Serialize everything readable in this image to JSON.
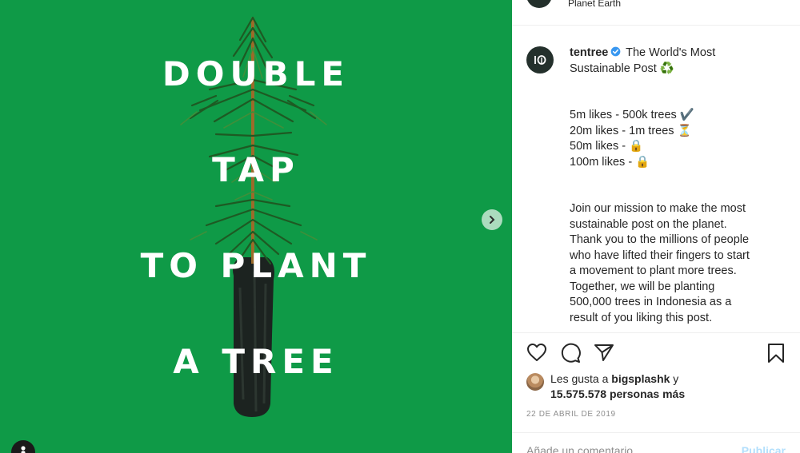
{
  "post": {
    "headline": [
      "DOUBLE",
      "TAP",
      "TO PLANT",
      "A TREE"
    ],
    "background_color": "#0f9a47",
    "next_icon": "chevron-right-icon",
    "user_tag_icon": "person-icon"
  },
  "header": {
    "location": "Planet Earth"
  },
  "caption": {
    "avatar_text": "10",
    "username": "tentree",
    "verified_icon": "verified-badge-icon",
    "lines": [
      "The World's Most",
      "Sustainable Post ♻️",
      "",
      "",
      "5m likes - 500k trees ✔️",
      "20m likes - 1m trees ⏳",
      "50m likes - 🔒",
      "100m likes - 🔒",
      "",
      "",
      "Join our mission to make the most",
      "sustainable post on the planet.",
      "Thank you to the millions of people",
      "who have lifted their fingers to start",
      "a movement to plant more trees.",
      "Together, we will be planting",
      "500,000 trees in Indonesia as a",
      "result of you liking this post."
    ]
  },
  "actions": {
    "like_icon": "heart-icon",
    "comment_icon": "comment-icon",
    "share_icon": "share-icon",
    "save_icon": "bookmark-icon"
  },
  "likes": {
    "prefix": "Les gusta a ",
    "user": "bigsplashk",
    "connector": " y",
    "count": "15.575.578 personas más"
  },
  "date": "22 DE ABRIL DE 2019",
  "comment": {
    "placeholder": "Añade un comentario...",
    "publish_label": "Publicar"
  },
  "colors": {
    "accent": "#0095f6",
    "publish_disabled": "#b2dffc",
    "muted": "#8e8e8e"
  }
}
